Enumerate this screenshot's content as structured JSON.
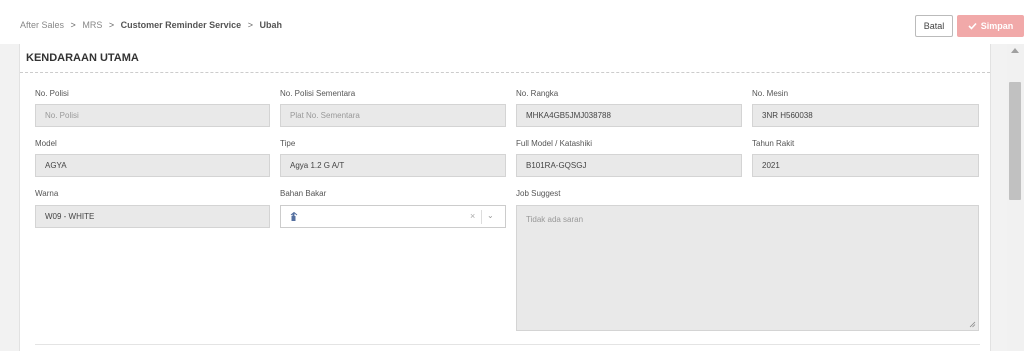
{
  "breadcrumb": {
    "items": [
      "After Sales",
      "MRS",
      "Customer Reminder Service",
      "Ubah"
    ],
    "separator": ">"
  },
  "actions": {
    "cancel_label": "Batal",
    "save_label": "Simpan",
    "save_icon": "check-icon"
  },
  "section": {
    "title": "KENDARAAN UTAMA"
  },
  "fields": {
    "no_polisi": {
      "label": "No. Polisi",
      "value": "",
      "placeholder": "No. Polisi"
    },
    "no_polisi_sementara": {
      "label": "No. Polisi Sementara",
      "value": "",
      "placeholder": "Plat No. Sementara"
    },
    "no_rangka": {
      "label": "No. Rangka",
      "value": "MHKA4GB5JMJ038788"
    },
    "no_mesin": {
      "label": "No. Mesin",
      "value": "3NR H560038"
    },
    "model": {
      "label": "Model",
      "value": "AGYA"
    },
    "tipe": {
      "label": "Tipe",
      "value": "Agya 1.2 G A/T"
    },
    "full_model": {
      "label": "Full Model / Katashiki",
      "value": "B101RA-GQSGJ"
    },
    "tahun_rakit": {
      "label": "Tahun Rakit",
      "value": "2021"
    },
    "warna": {
      "label": "Warna",
      "value": "W09 - WHITE"
    },
    "bahan_bakar": {
      "label": "Bahan Bakar",
      "value": "",
      "icon": "fuel-pump-icon",
      "clear": "×",
      "arrow": "⌄"
    },
    "job_suggest": {
      "label": "Job Suggest",
      "placeholder": "Tidak ada saran"
    }
  },
  "colors": {
    "accent_save": "#f1a9a9",
    "field_bg": "#e9e9e9"
  }
}
